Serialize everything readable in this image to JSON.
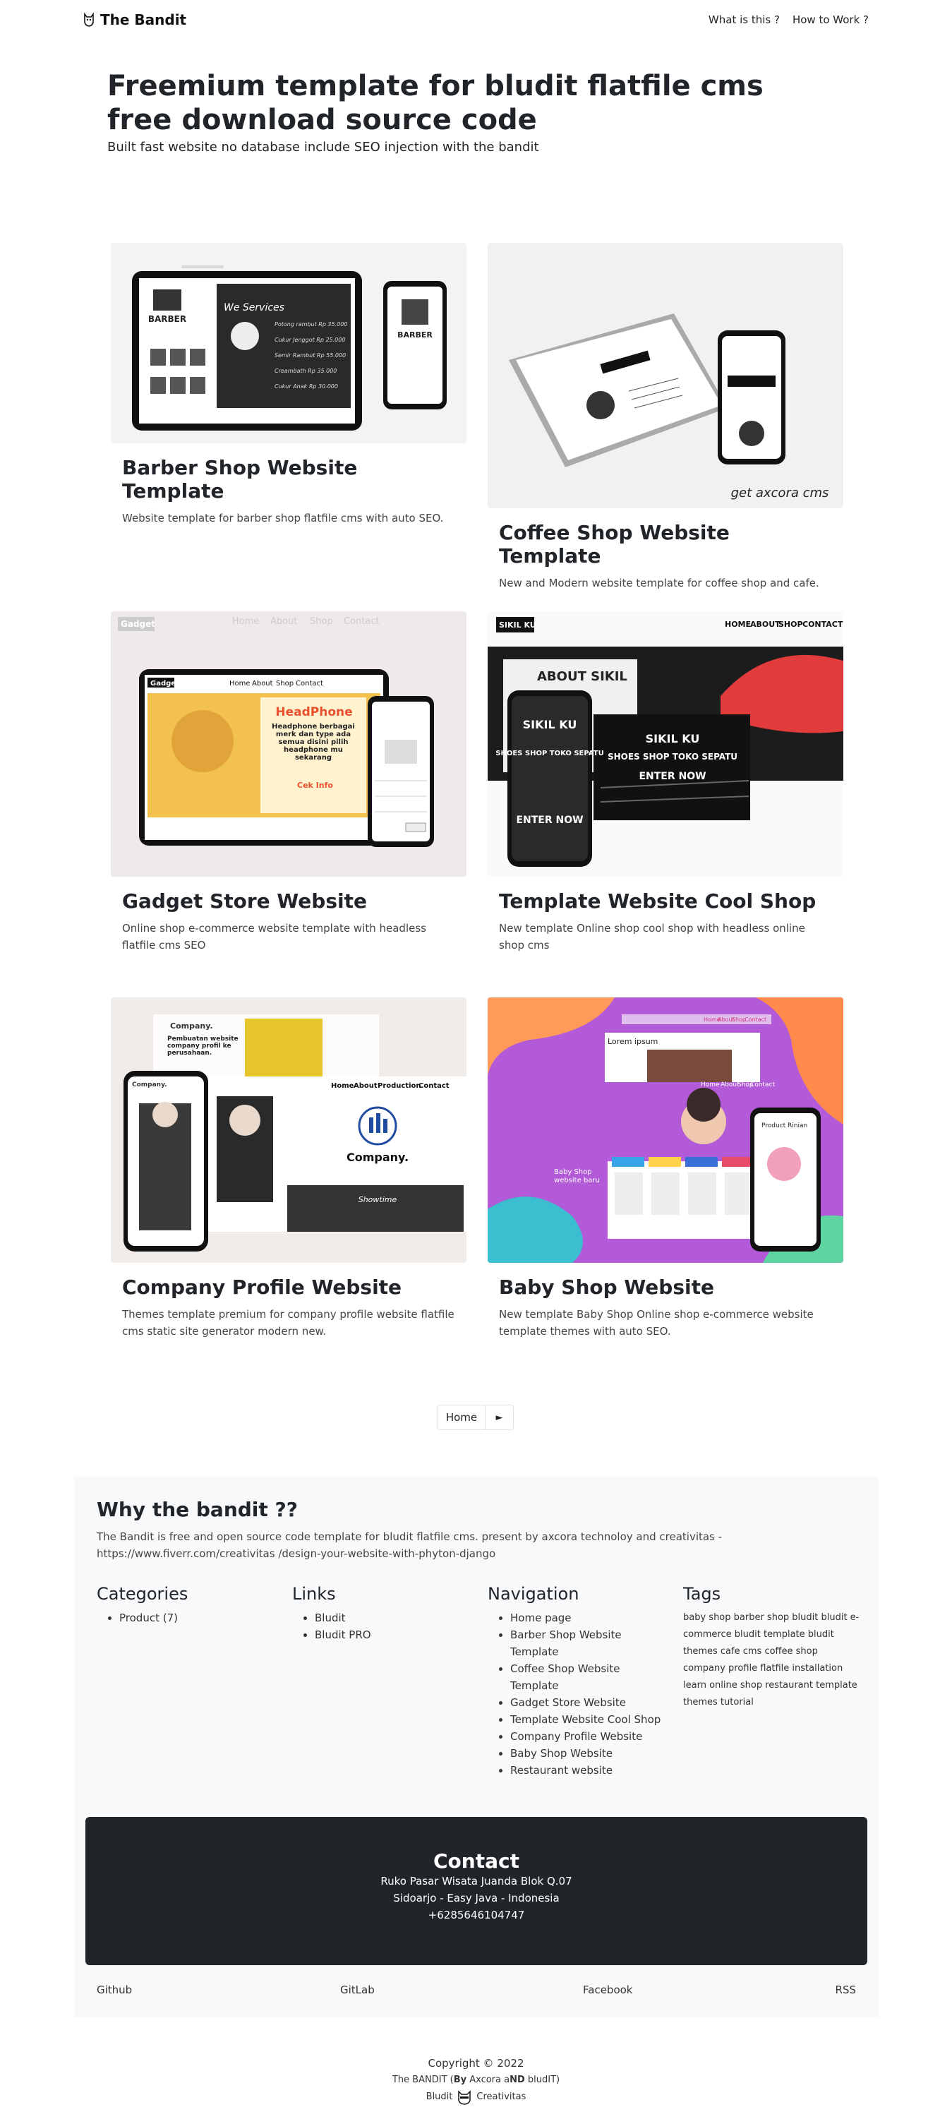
{
  "nav": {
    "brand": "The Bandit",
    "links": [
      "What is this ?",
      "How to Work ?"
    ]
  },
  "hero": {
    "title": "Freemium template for bludit flatfile cms free download source code",
    "subtitle": "Built fast website no database include SEO injection with the bandit"
  },
  "cards": [
    {
      "title": "Barber Shop Website Template",
      "desc": "Website template for barber shop flatfile cms with auto SEO.",
      "img": {
        "label": "BARBER",
        "script": "We Services",
        "prices": [
          "Potong rambut Rp 35.000",
          "Cukur Jenggot Rp 25.000",
          "Semir Rambut Rp 55.000",
          "Creambath Rp 35.000",
          "Cukur Anak Rp 30.000"
        ]
      }
    },
    {
      "title": "Coffee Shop Website Template",
      "desc": "New and Modern website template for coffee shop and cafe.",
      "img": {
        "caption": "get axcora cms"
      }
    },
    {
      "title": "Gadget Store Website",
      "desc": "Online shop e-commerce website template with headless flatfile cms SEO",
      "img": {
        "logo": "Gadget",
        "menu": [
          "Home",
          "About",
          "Shop",
          "Contact"
        ],
        "headline": "HeadPhone",
        "tag": "Headphone berbagai merk dan type ada semua disini pilih headphone mu sekarang",
        "cta": "Cek Info"
      }
    },
    {
      "title": "Template Website Cool Shop",
      "desc": "New template Online shop cool shop with headless online shop cms",
      "img": {
        "logo": "SIKIL KU",
        "menu": [
          "HOME",
          "ABOUT",
          "SHOP",
          "CONTACT"
        ],
        "about": "ABOUT SIKIL",
        "hero": "SIKIL KU",
        "sub": "SHOES SHOP TOKO SEPATU",
        "cta": "ENTER NOW"
      }
    },
    {
      "title": "Company Profile Website",
      "desc": "Themes template premium for company profile website flatfile cms static site generator modern new.",
      "img": {
        "brand": "Company.",
        "menu": [
          "Home",
          "About",
          "Production",
          "Contact"
        ],
        "tagline": "Pembuatan website company profil ke perusahaan.",
        "showtime": "Showtime"
      }
    },
    {
      "title": "Baby Shop Website",
      "desc": "New template Baby Shop Online shop e-commerce website template themes with auto SEO.",
      "img": {
        "menu": [
          "Home",
          "About",
          "Shop",
          "Contact"
        ],
        "promo": "Baby Shop website baru",
        "product": "Product Rinian",
        "lorem": "Lorem ipsum"
      }
    }
  ],
  "pagination": {
    "home": "Home",
    "next": "►"
  },
  "footer": {
    "why_title": "Why the bandit ??",
    "why_text": "The Bandit is free and open source code template for bludit flatfile cms. present by axcora technoloy and creativitas - https://www.fiverr.com/creativitas /design-your-website-with-phyton-django",
    "categories": {
      "title": "Categories",
      "items": [
        "Product (7)"
      ]
    },
    "links": {
      "title": "Links",
      "items": [
        "Bludit",
        "Bludit PRO"
      ]
    },
    "navigation": {
      "title": "Navigation",
      "items": [
        "Home page",
        "Barber Shop Website Template",
        "Coffee Shop Website Template",
        "Gadget Store Website",
        "Template Website Cool Shop",
        "Company Profile Website",
        "Baby Shop Website",
        "Restaurant website"
      ]
    },
    "tags": {
      "title": "Tags",
      "text": "baby shop barber shop bludit bludit e-commerce bludit template bludit themes cafe cms coffee shop company profile flatfile installation learn online shop restaurant template themes tutorial"
    },
    "contact": {
      "title": "Contact",
      "address1": "Ruko Pasar Wisata Juanda Blok Q.07",
      "address2": "Sidoarjo - Easy Java - Indonesia",
      "phone": "+6285646104747"
    },
    "social": [
      "Github",
      "GitLab",
      "Facebook",
      "RSS"
    ]
  },
  "copyright": {
    "line1": "Copyright © 2022",
    "line2_a": "The BANDIT (",
    "line2_b": "By",
    "line2_c": " Axcora a",
    "line2_d": "ND",
    "line2_e": " bludIT",
    "line2_f": ")",
    "line3_left": "Bludit",
    "line3_right": "Creativitas"
  }
}
